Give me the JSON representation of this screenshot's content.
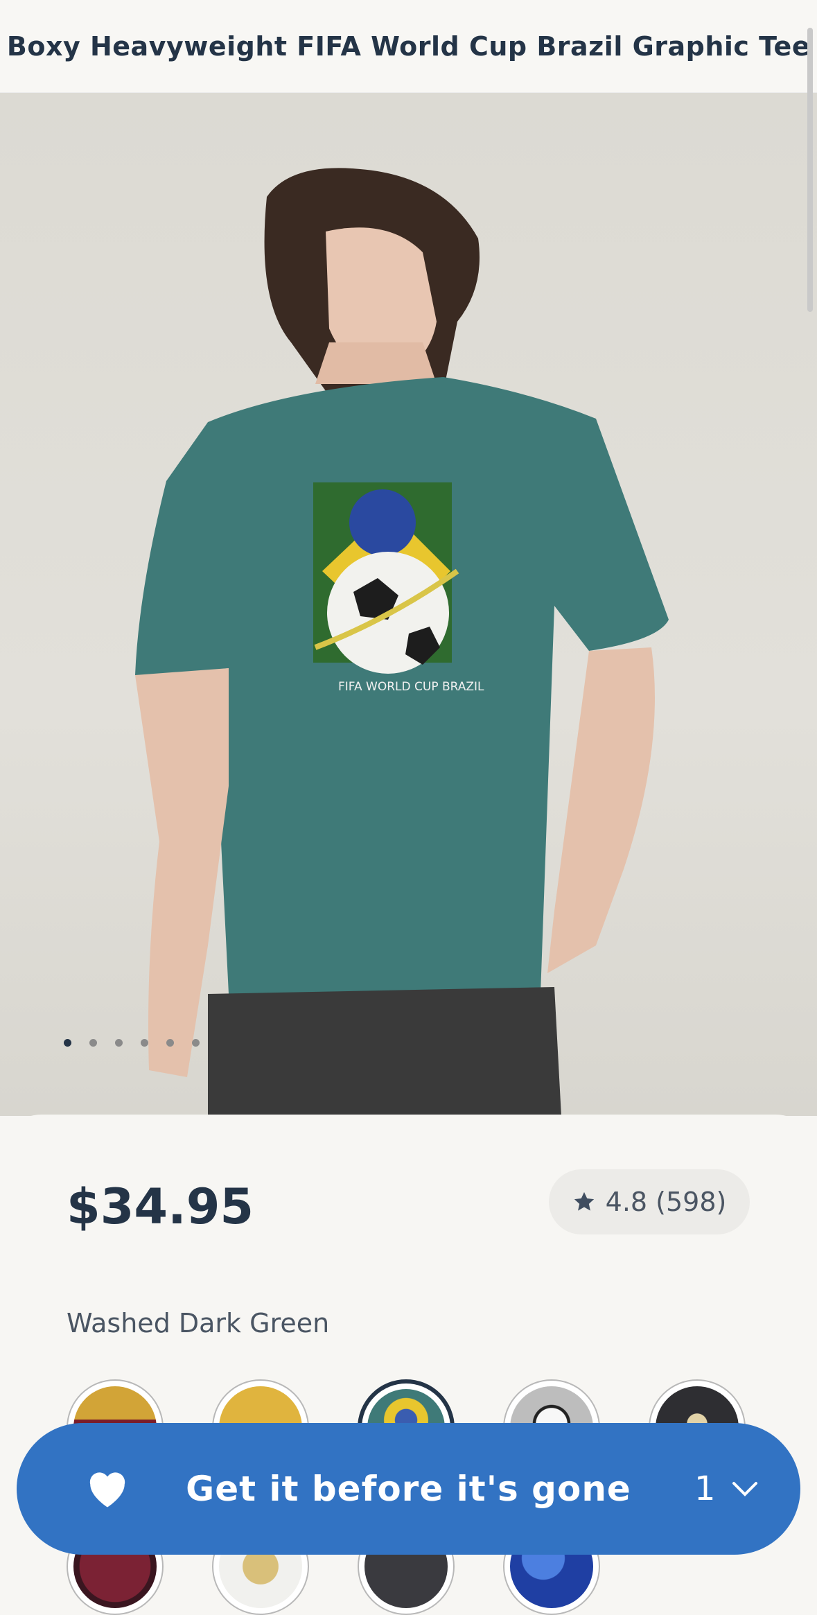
{
  "header": {
    "title": "Boxy Heavyweight FIFA World Cup Brazil Graphic Tee"
  },
  "gallery": {
    "image": "model-wearing-green-brazil-tee",
    "dots": [
      true,
      false,
      false,
      false,
      false,
      false
    ],
    "graphic_text": "FIFA WORLD CUP BRAZIL"
  },
  "product": {
    "price": "$34.95",
    "rating": "4.8 (598)",
    "color_name": "Washed Dark Green"
  },
  "swatches": [
    {
      "name": "fcb-red-blue",
      "selected": false
    },
    {
      "name": "fcb-yellow",
      "selected": false
    },
    {
      "name": "brazil-green",
      "selected": true
    },
    {
      "name": "soccer-ball-gray",
      "selected": false
    },
    {
      "name": "real-madrid-black",
      "selected": false
    },
    {
      "name": "west-ham",
      "selected": false
    },
    {
      "name": "real-madrid-white",
      "selected": false
    },
    {
      "name": "argentina",
      "selected": false
    },
    {
      "name": "blue-pattern",
      "selected": false
    }
  ],
  "cta": {
    "label": "Get it before it's gone",
    "quantity": "1"
  },
  "colors": {
    "accent": "#3273c3",
    "text": "#243447",
    "shirt": "#3f7a78"
  }
}
